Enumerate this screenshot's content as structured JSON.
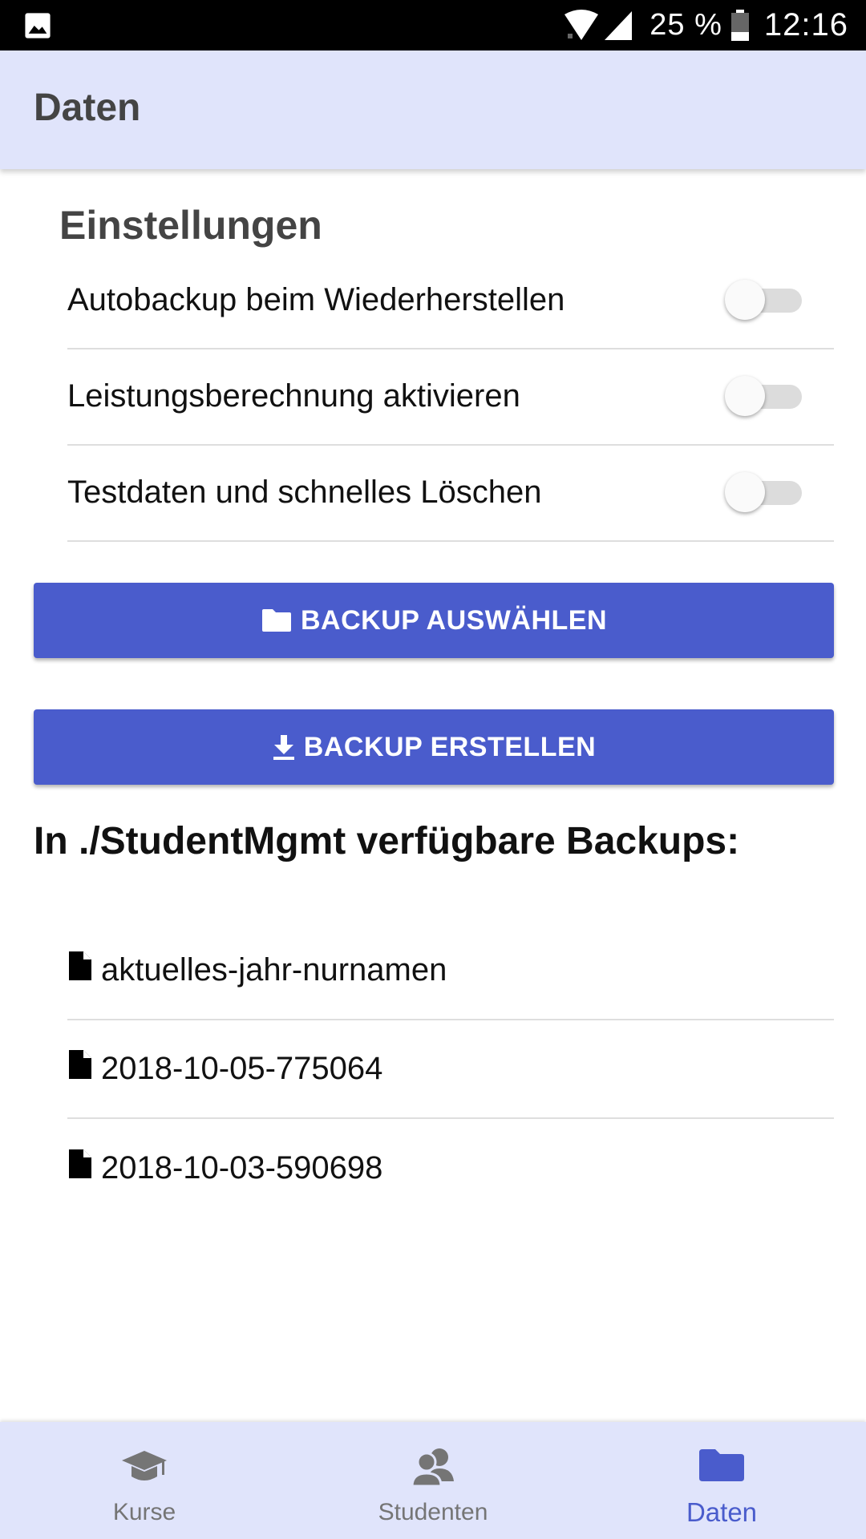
{
  "status_bar": {
    "battery_percent": "25 %",
    "time": "12:16",
    "icons": [
      "image-icon",
      "wifi-icon",
      "signal-icon",
      "battery-icon"
    ]
  },
  "app_bar": {
    "title": "Daten"
  },
  "settings": {
    "title": "Einstellungen",
    "items": [
      {
        "label": "Autobackup beim Wiederherstellen",
        "enabled": false
      },
      {
        "label": "Leistungsberechnung aktivieren",
        "enabled": false
      },
      {
        "label": "Testdaten und schnelles Löschen",
        "enabled": false
      }
    ]
  },
  "actions": {
    "select_backup": {
      "label": "BACKUP AUSWÄHLEN",
      "icon": "folder-icon"
    },
    "create_backup": {
      "label": "BACKUP ERSTELLEN",
      "icon": "download-icon"
    }
  },
  "backups": {
    "heading": "In ./StudentMgmt verfügbare Backups:",
    "files": [
      {
        "name": "aktuelles-jahr-nurnamen",
        "icon": "file-icon"
      },
      {
        "name": "2018-10-05-775064",
        "icon": "file-icon"
      },
      {
        "name": "2018-10-03-590698",
        "icon": "file-icon"
      }
    ]
  },
  "bottom_nav": {
    "items": [
      {
        "label": "Kurse",
        "icon": "graduation-cap-icon",
        "active": false
      },
      {
        "label": "Studenten",
        "icon": "users-icon",
        "active": false
      },
      {
        "label": "Daten",
        "icon": "folder-icon",
        "active": true
      }
    ],
    "active_color": "#4a5ccc"
  },
  "colors": {
    "accent": "#4a5ccc",
    "bar_background": "#e0e4fb"
  }
}
